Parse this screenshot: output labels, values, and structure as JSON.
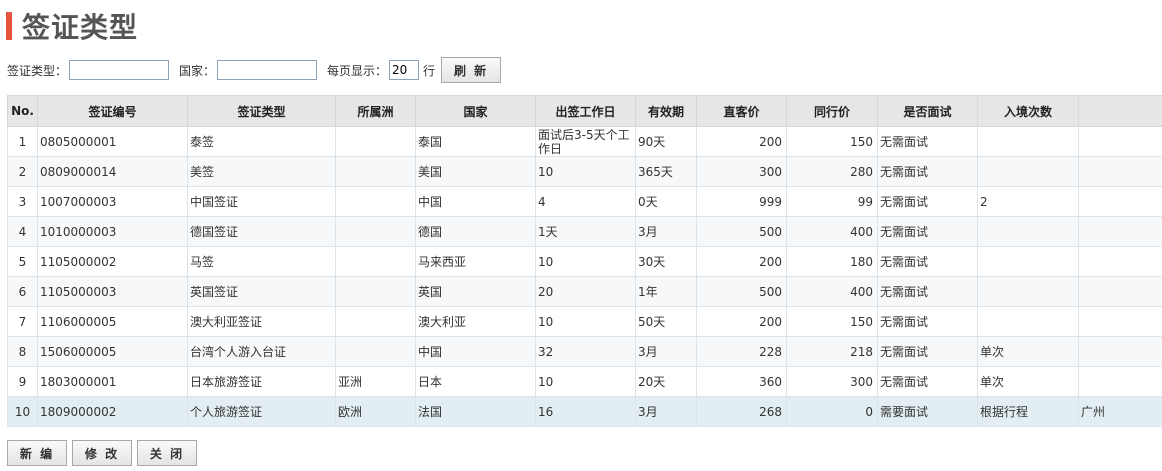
{
  "page": {
    "title": "签证类型"
  },
  "filters": {
    "visa_type_label": "签证类型：",
    "visa_type_value": "",
    "country_label": "国家：",
    "country_value": "",
    "per_page_label": "每页显示：",
    "per_page_value": "20",
    "per_page_unit": "行",
    "refresh_label": "刷 新"
  },
  "table": {
    "headers": [
      "No.",
      "签证编号",
      "签证类型",
      "所属洲",
      "国家",
      "出签工作日",
      "有效期",
      "直客价",
      "同行价",
      "是否面试",
      "入境次数",
      ""
    ],
    "rows": [
      [
        "1",
        "0805000001",
        "泰签",
        "",
        "泰国",
        "面试后3-5天个工作日",
        "90天",
        "200",
        "150",
        "无需面试",
        "",
        ""
      ],
      [
        "2",
        "0809000014",
        "美签",
        "",
        "美国",
        "10",
        "365天",
        "300",
        "280",
        "无需面试",
        "",
        ""
      ],
      [
        "3",
        "1007000003",
        "中国签证",
        "",
        "中国",
        "4",
        "0天",
        "999",
        "99",
        "无需面试",
        "2",
        ""
      ],
      [
        "4",
        "1010000003",
        "德国签证",
        "",
        "德国",
        "1天",
        "3月",
        "500",
        "400",
        "无需面试",
        "",
        ""
      ],
      [
        "5",
        "1105000002",
        "马签",
        "",
        "马来西亚",
        "10",
        "30天",
        "200",
        "180",
        "无需面试",
        "",
        ""
      ],
      [
        "6",
        "1105000003",
        "英国签证",
        "",
        "英国",
        "20",
        "1年",
        "500",
        "400",
        "无需面试",
        "",
        ""
      ],
      [
        "7",
        "1106000005",
        "澳大利亚签证",
        "",
        "澳大利亚",
        "10",
        "50天",
        "200",
        "150",
        "无需面试",
        "",
        ""
      ],
      [
        "8",
        "1506000005",
        "台湾个人游入台证",
        "",
        "中国",
        "32",
        "3月",
        "228",
        "218",
        "无需面试",
        "单次",
        ""
      ],
      [
        "9",
        "1803000001",
        "日本旅游签证",
        "亚洲",
        "日本",
        "10",
        "20天",
        "360",
        "300",
        "无需面试",
        "单次",
        ""
      ],
      [
        "10",
        "1809000002",
        "个人旅游签证",
        "欧洲",
        "法国",
        "16",
        "3月",
        "268",
        "0",
        "需要面试",
        "根据行程",
        "广州"
      ]
    ]
  },
  "actions": {
    "new_label": "新 编",
    "edit_label": "修 改",
    "close_label": "关 闭"
  }
}
